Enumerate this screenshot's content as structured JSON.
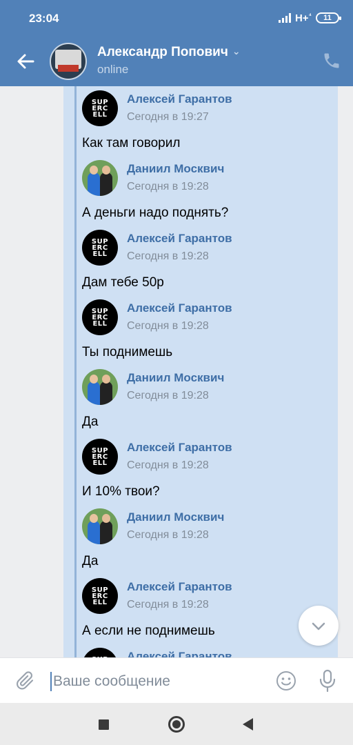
{
  "status": {
    "time": "23:04",
    "network": "H+",
    "network_sub": "⁴",
    "battery": "11"
  },
  "header": {
    "title": "Александр Попович",
    "subtitle": "online"
  },
  "messages": [
    {
      "name": "Алексей Гарантов",
      "date": "Сегодня в 19:27",
      "text": "Как там говорил",
      "avatar": "supercell"
    },
    {
      "name": "Даниил Москвич",
      "date": "Сегодня в 19:28",
      "text": "А деньги надо поднять?",
      "avatar": "photo"
    },
    {
      "name": "Алексей Гарантов",
      "date": "Сегодня в 19:28",
      "text": "Дам тебе 50р",
      "avatar": "supercell"
    },
    {
      "name": "Алексей Гарантов",
      "date": "Сегодня в 19:28",
      "text": "Ты поднимешь",
      "avatar": "supercell"
    },
    {
      "name": "Даниил Москвич",
      "date": "Сегодня в 19:28",
      "text": "Да",
      "avatar": "photo"
    },
    {
      "name": "Алексей Гарантов",
      "date": "Сегодня в 19:28",
      "text": "И 10% твои?",
      "avatar": "supercell"
    },
    {
      "name": "Даниил Москвич",
      "date": "Сегодня в 19:28",
      "text": "Да",
      "avatar": "photo"
    },
    {
      "name": "Алексей Гарантов",
      "date": "Сегодня в 19:28",
      "text": "А если не поднимешь",
      "avatar": "supercell"
    },
    {
      "name": "Алексей Гарантов",
      "date": "",
      "text": "",
      "avatar": "supercell"
    }
  ],
  "composer": {
    "placeholder": "Ваше сообщение"
  },
  "icons": {
    "back": "arrow-left-icon",
    "call": "phone-icon",
    "attach": "paperclip-icon",
    "emoji": "smile-icon",
    "voice": "microphone-icon",
    "scroll_down": "chevron-down-icon"
  },
  "colors": {
    "header_bg": "#5181b8",
    "bubble_bg": "#cfe0f3",
    "name": "#3e6ea6",
    "date": "#818c99"
  }
}
